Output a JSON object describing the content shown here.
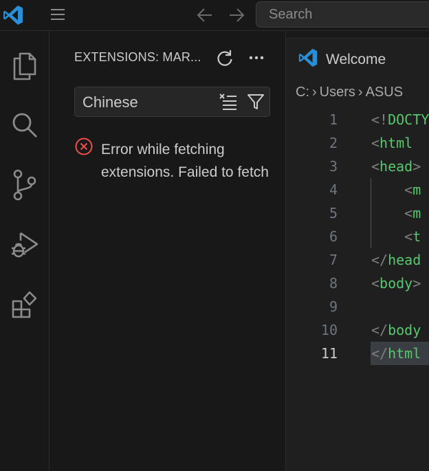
{
  "titlebar": {
    "search_placeholder": "Search"
  },
  "sidebar": {
    "title": "EXTENSIONS: MAR...",
    "search_value": "Chinese",
    "error_text": "Error while fetching extensions. Failed to fetch"
  },
  "editor": {
    "tab_label": "Welcome",
    "breadcrumb": [
      "C:",
      "Users",
      "ASUS"
    ],
    "lines": [
      {
        "num": "1",
        "text": "<!DOCTY"
      },
      {
        "num": "2",
        "text": "<html "
      },
      {
        "num": "3",
        "text": "<head>"
      },
      {
        "num": "4",
        "text": "    <m"
      },
      {
        "num": "5",
        "text": "    <m"
      },
      {
        "num": "6",
        "text": "    <t"
      },
      {
        "num": "7",
        "text": "</head"
      },
      {
        "num": "8",
        "text": "<body>"
      },
      {
        "num": "9",
        "text": ""
      },
      {
        "num": "10",
        "text": "</body"
      },
      {
        "num": "11",
        "text": "</html"
      }
    ]
  },
  "colors": {
    "accent": "#3d9cd9",
    "error": "#f14c4c",
    "tag_green": "#56c96e"
  },
  "icons": {
    "activity": [
      "explorer-icon",
      "search-icon",
      "source-control-icon",
      "run-debug-icon",
      "extensions-icon"
    ]
  }
}
